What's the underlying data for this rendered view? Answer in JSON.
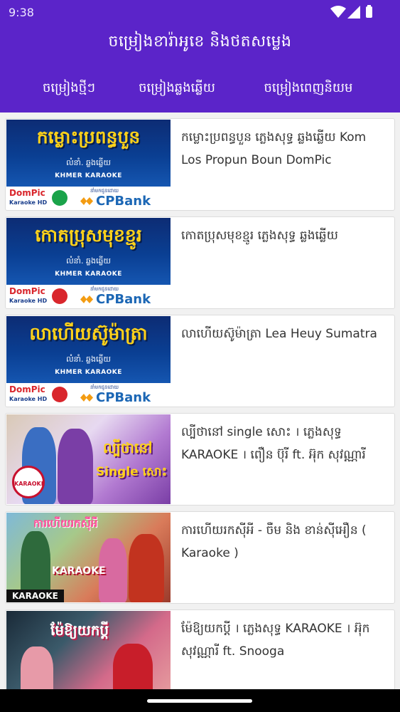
{
  "status_bar": {
    "time": "9:38"
  },
  "app": {
    "title": "ចម្រៀងខារ៉ាអូខេ និងថតសម្លេង",
    "accent": "#5b24c9"
  },
  "tabs": [
    {
      "label": "ចម្រៀងថ្មីៗ"
    },
    {
      "label": "ចម្រៀងឆ្លងឆ្លើយ"
    },
    {
      "label": "ចម្រៀងពេញនិយម"
    }
  ],
  "songs": [
    {
      "title": "កម្លោះប្រពន្ធបួន ភ្លេងសុទ្ធ ឆ្លងឆ្លើយ Kom Los Propun Boun DomPic",
      "thumb": {
        "headline": "កម្លោះប្រពន្ធបួន",
        "credit": "លំនាំ. ឆ្លងឆ្លើយ",
        "tag": "KHMER KARAOKE",
        "brand": "DomPic",
        "brand_sub": "Karaoke HD",
        "sponsor_label": "នាំមកជូនដោយ",
        "sponsor": "CPBank"
      }
    },
    {
      "title": "កោតប្រុសមុខខ្មូរ ភ្លេងសុទ្ធ ឆ្លងឆ្លើយ",
      "thumb": {
        "headline": "កោតប្រុសមុខខ្មូរ",
        "credit": "លំនាំ. ឆ្លងឆ្លើយ",
        "tag": "KHMER KARAOKE",
        "brand": "DomPic",
        "brand_sub": "Karaoke HD",
        "sponsor_label": "នាំមកជូនដោយ",
        "sponsor": "CPBank"
      }
    },
    {
      "title": "លាហើយស៊ូម៉ាត្រា Lea Heuy Sumatra",
      "thumb": {
        "headline": "លាហើយស៊ូម៉ាត្រា",
        "credit": "លំនាំ. ឆ្លងឆ្លើយ",
        "tag": "KHMER KARAOKE",
        "brand": "DomPic",
        "brand_sub": "Karaoke HD",
        "sponsor_label": "នាំមកជូនដោយ",
        "sponsor": "CPBank"
      }
    },
    {
      "title": "ល្បីថានៅ single សោះ । ភ្លេងសុទ្ធ KARAOKE । ពឿន ប៊ុរី ft. អ៊ុក សុវណ្ណារី",
      "thumb": {
        "headline": "ល្បីថានៅ",
        "headline2": "Single សោះ",
        "logo_text": "KARAOKE"
      }
    },
    {
      "title": "ការហើយរកស៊ីអី - ចឺម និង ខាន់ស៊ីអឿន ( Karaoke )",
      "thumb": {
        "headline": "ការហើយរកស៊ីអី",
        "tag": "KARAOKE",
        "badge": "KARAOKE"
      }
    },
    {
      "title": "ម៉ែឱ្យយកប្ដី । ភ្លេងសុទ្ធ KARAOKE । អ៊ុក សុវណ្ណារី ft. Snooga",
      "thumb": {
        "headline": "ម៉ែឱ្យយកប្ដី"
      }
    }
  ]
}
